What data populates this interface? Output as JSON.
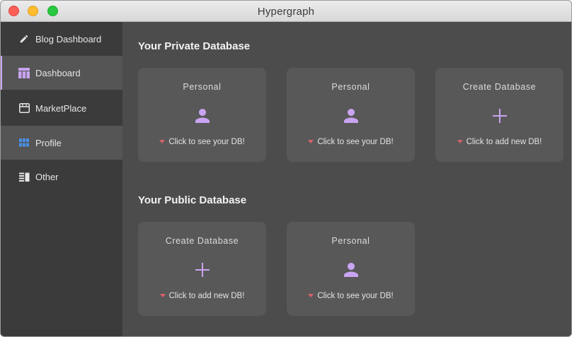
{
  "window": {
    "title": "Hypergraph"
  },
  "sidebar": {
    "items": [
      {
        "label": "Blog Dashboard",
        "icon": "pencil-icon"
      },
      {
        "label": "Dashboard",
        "icon": "table-icon"
      },
      {
        "label": "MarketPlace",
        "icon": "store-icon"
      },
      {
        "label": "Profile",
        "icon": "grid-icon"
      },
      {
        "label": "Other",
        "icon": "list-icon"
      }
    ]
  },
  "main": {
    "private": {
      "title": "Your Private Database",
      "cards": [
        {
          "title": "Personal",
          "icon": "person-icon",
          "hint": "Click to see your DB!"
        },
        {
          "title": "Personal",
          "icon": "person-icon",
          "hint": "Click to see your DB!"
        },
        {
          "title": "Create Database",
          "icon": "plus-icon",
          "hint": "Click to add new DB!"
        }
      ]
    },
    "public": {
      "title": "Your Public Database",
      "cards": [
        {
          "title": "Create Database",
          "icon": "plus-icon",
          "hint": "Click to add new DB!"
        },
        {
          "title": "Personal",
          "icon": "person-icon",
          "hint": "Click to see your DB!"
        }
      ]
    }
  },
  "colors": {
    "accent": "#c9a4f1",
    "caret": "#d9606a",
    "profile_icon": "#4a8fe7"
  }
}
